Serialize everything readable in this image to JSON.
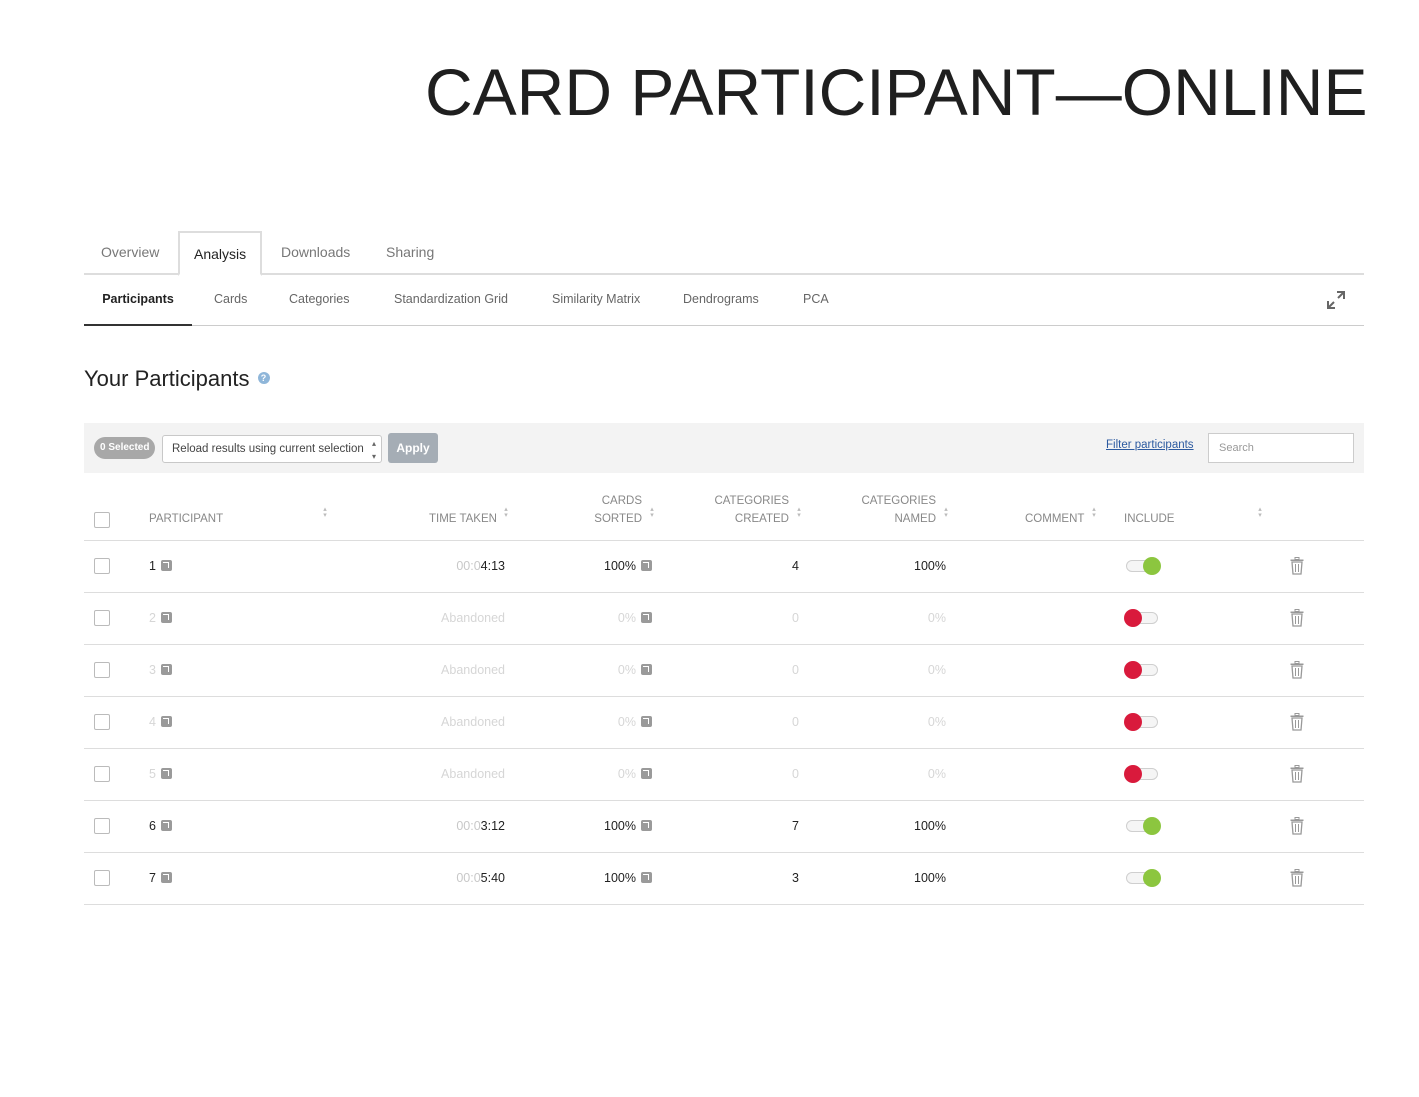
{
  "slide": {
    "title": "CARD PARTICIPANT—ONLINE"
  },
  "main_tabs": [
    {
      "label": "Overview",
      "active": false
    },
    {
      "label": "Analysis",
      "active": true
    },
    {
      "label": "Downloads",
      "active": false
    },
    {
      "label": "Sharing",
      "active": false
    }
  ],
  "sub_tabs": [
    {
      "label": "Participants",
      "active": true
    },
    {
      "label": "Cards",
      "active": false
    },
    {
      "label": "Categories",
      "active": false
    },
    {
      "label": "Standardization Grid",
      "active": false
    },
    {
      "label": "Similarity Matrix",
      "active": false
    },
    {
      "label": "Dendrograms",
      "active": false
    },
    {
      "label": "PCA",
      "active": false
    }
  ],
  "section": {
    "title": "Your Participants",
    "help_glyph": "?"
  },
  "toolbar": {
    "selected_badge": "0 Selected",
    "reload_select_value": "Reload results using current selection",
    "select_arrows": "▴▾",
    "apply_label": "Apply",
    "filter_link": "Filter participants",
    "search_placeholder": "Search"
  },
  "table": {
    "headers": {
      "participant": "PARTICIPANT",
      "time_taken": "TIME TAKEN",
      "cards_sorted_1": "CARDS",
      "cards_sorted_2": "SORTED",
      "categories_created_1": "CATEGORIES",
      "categories_created_2": "CREATED",
      "categories_named_1": "CATEGORIES",
      "categories_named_2": "NAMED",
      "comment": "COMMENT",
      "include": "INCLUDE"
    },
    "sort_glyph": "▴▾",
    "rows": [
      {
        "id": "1",
        "time_prefix": "00:0",
        "time": "4:13",
        "cards_sorted": "100%",
        "categories_created": "4",
        "categories_named": "100%",
        "include": true,
        "abandoned": false
      },
      {
        "id": "2",
        "time_prefix": "",
        "time": "Abandoned",
        "cards_sorted": "0%",
        "categories_created": "0",
        "categories_named": "0%",
        "include": false,
        "abandoned": true
      },
      {
        "id": "3",
        "time_prefix": "",
        "time": "Abandoned",
        "cards_sorted": "0%",
        "categories_created": "0",
        "categories_named": "0%",
        "include": false,
        "abandoned": true
      },
      {
        "id": "4",
        "time_prefix": "",
        "time": "Abandoned",
        "cards_sorted": "0%",
        "categories_created": "0",
        "categories_named": "0%",
        "include": false,
        "abandoned": true
      },
      {
        "id": "5",
        "time_prefix": "",
        "time": "Abandoned",
        "cards_sorted": "0%",
        "categories_created": "0",
        "categories_named": "0%",
        "include": false,
        "abandoned": true
      },
      {
        "id": "6",
        "time_prefix": "00:0",
        "time": "3:12",
        "cards_sorted": "100%",
        "categories_created": "7",
        "categories_named": "100%",
        "include": true,
        "abandoned": false
      },
      {
        "id": "7",
        "time_prefix": "00:0",
        "time": "5:40",
        "cards_sorted": "100%",
        "categories_created": "3",
        "categories_named": "100%",
        "include": true,
        "abandoned": false
      }
    ]
  },
  "colors": {
    "toggle_on": "#8cc63f",
    "toggle_off": "#d91a3c",
    "link": "#2c5aa0",
    "apply_button": "#a5adb5"
  },
  "icons": {
    "expand": "expand-arrows-icon",
    "help": "question-circle-icon",
    "view": "image-link-icon",
    "delete": "trash-icon"
  }
}
